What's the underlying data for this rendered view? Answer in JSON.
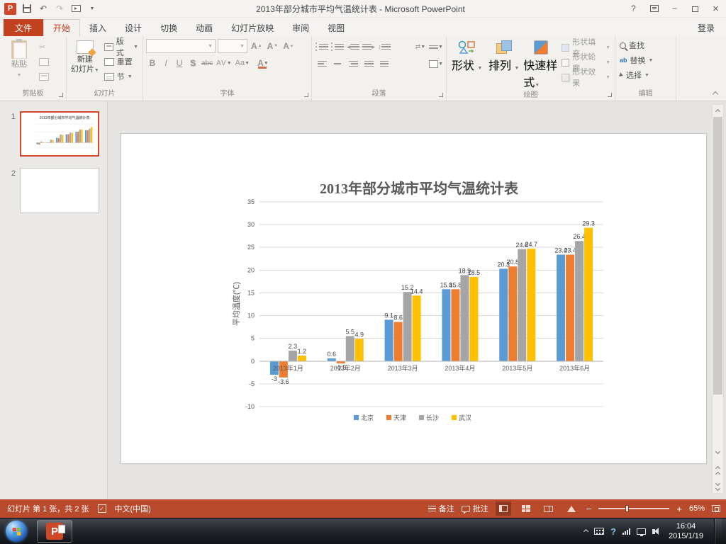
{
  "theme": {
    "accent": "#c2411f",
    "statusbar": "#b94a2c"
  },
  "titlebar": {
    "title": "2013年部分城市平均气温统计表 - Microsoft PowerPoint",
    "signin": "登录"
  },
  "icons": {
    "ppt_logo": "P",
    "undo": "↶",
    "redo": "↷",
    "dropdown": "▼",
    "help": "?",
    "minimize": "−",
    "close": "×",
    "cut": "✂",
    "check": "✓",
    "bold": "B",
    "italic": "I",
    "underline": "U",
    "shadow": "S",
    "strike": "abc",
    "spacing": "AV",
    "case": "Aa",
    "font_color": "A",
    "grow_font": "A",
    "shrink_font": "A",
    "clear_format": "A",
    "replace_ab": "ab",
    "minus": "−",
    "plus": "+"
  },
  "tabs": {
    "file": "文件",
    "items": [
      {
        "id": "home",
        "label": "开始",
        "active": true
      },
      {
        "id": "insert",
        "label": "插入"
      },
      {
        "id": "design",
        "label": "设计"
      },
      {
        "id": "transitions",
        "label": "切换"
      },
      {
        "id": "animations",
        "label": "动画"
      },
      {
        "id": "slideshow",
        "label": "幻灯片放映"
      },
      {
        "id": "review",
        "label": "审阅"
      },
      {
        "id": "view",
        "label": "视图"
      }
    ]
  },
  "ribbon": {
    "clipboard": {
      "group": "剪贴板",
      "paste": "粘贴",
      "cut": "剪切",
      "copy": "复制",
      "format_painter": "格式刷"
    },
    "slides": {
      "group": "幻灯片",
      "new_slide_1": "新建",
      "new_slide_2": "幻灯片",
      "layout": "版式",
      "reset": "重置",
      "section": "节"
    },
    "font": {
      "group": "字体"
    },
    "paragraph": {
      "group": "段落"
    },
    "drawing": {
      "group": "绘图",
      "shapes": "形状",
      "arrange": "排列",
      "quick_styles": "快速样式",
      "shape_fill": "形状填充",
      "shape_outline": "形状轮廓",
      "shape_effects": "形状效果"
    },
    "editing": {
      "group": "编辑",
      "find": "查找",
      "replace": "替换",
      "select": "选择"
    }
  },
  "slide_panel": {
    "slide1_num": "1",
    "slide2_num": "2"
  },
  "chart_data": {
    "type": "bar",
    "title": "2013年部分城市平均气温统计表",
    "ylabel": "平均温度(℃)",
    "ylim": [
      -10,
      35
    ],
    "ytick_step": 5,
    "grid": true,
    "legend_position": "bottom",
    "categories": [
      "2013年1月",
      "2013年2月",
      "2013年3月",
      "2013年4月",
      "2013年5月",
      "2013年6月"
    ],
    "series": [
      {
        "name": "北京",
        "color": "#5b9bd5",
        "values": [
          -3,
          0.6,
          9.1,
          15.8,
          20.3,
          23.4
        ]
      },
      {
        "name": "天津",
        "color": "#ed7d31",
        "values": [
          -3.6,
          -0.5,
          8.6,
          15.8,
          20.8,
          23.4
        ]
      },
      {
        "name": "长沙",
        "color": "#a5a5a5",
        "values": [
          2.3,
          5.5,
          15.2,
          18.9,
          24.6,
          26.4
        ]
      },
      {
        "name": "武汉",
        "color": "#ffc000",
        "values": [
          1.2,
          4.9,
          14.4,
          18.5,
          24.7,
          29.3
        ]
      }
    ]
  },
  "statusbar": {
    "slide_info": "幻灯片 第 1 张，共 2 张",
    "language": "中文(中国)",
    "notes": "备注",
    "comments": "批注",
    "zoom": "65%"
  },
  "taskbar": {
    "time": "16:04",
    "date": "2015/1/19"
  }
}
